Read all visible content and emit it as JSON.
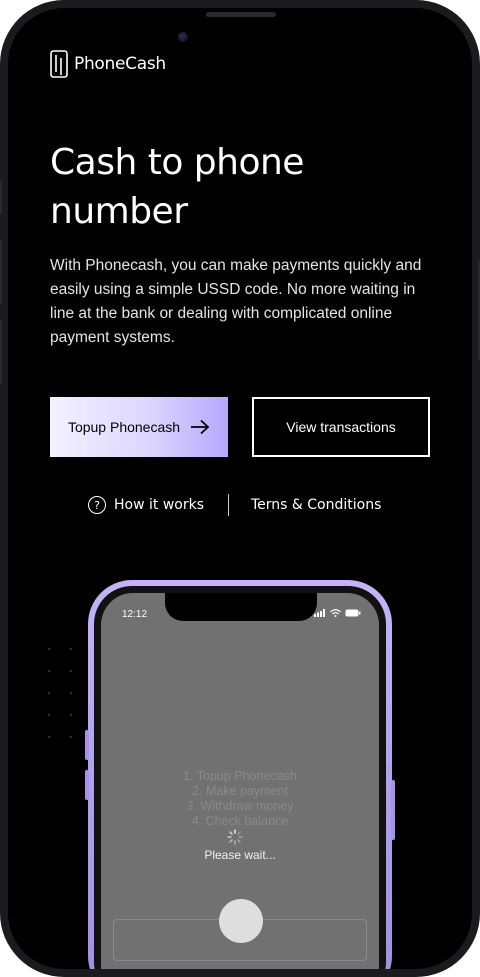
{
  "brand": {
    "name": "PhoneCash"
  },
  "hero": {
    "title": "Cash to phone number",
    "description": "With Phonecash, you can make payments quickly and easily using a simple USSD code. No more waiting in line at the bank or dealing with complicated online payment systems."
  },
  "actions": {
    "primary_label": "Topup Phonecash",
    "secondary_label": "View transactions"
  },
  "links": {
    "how_it_works": "How it works",
    "terms": "Terns & Conditions"
  },
  "mockup": {
    "time": "12:12",
    "menu": [
      "1. Topup Phonecash",
      "2. Make payment",
      "3. Withdraw money",
      "4. Check balance"
    ],
    "wait_text": "Please wait..."
  },
  "colors": {
    "background": "#000000",
    "accent": "#b6a8ff",
    "frame": "#1b1b1d"
  }
}
